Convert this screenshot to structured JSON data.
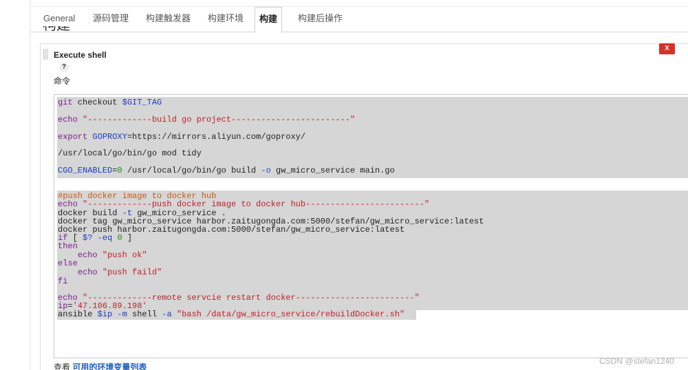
{
  "tabs": [
    {
      "label": "General",
      "active": false
    },
    {
      "label": "源码管理",
      "active": false
    },
    {
      "label": "构建触发器",
      "active": false
    },
    {
      "label": "构建环境",
      "active": false
    },
    {
      "label": "构建",
      "active": true
    },
    {
      "label": "构建后操作",
      "active": false
    }
  ],
  "section_title": "构建",
  "step": {
    "title": "Execute shell",
    "help_label": "?",
    "delete_label": "X",
    "field_label": "命令"
  },
  "script_lines": [
    "git checkout $GIT_TAG",
    "echo \"-------------build go project------------------------\"",
    "export GOPROXY=https://mirrors.aliyun.com/goproxy/",
    "/usr/local/go/bin/go mod tidy",
    "CGO_ENABLED=0 /usr/local/go/bin/go build -o gw_micro_service main.go",
    "#push docker image to docker hub",
    "echo \"-------------push docker image to docker hub------------------------\"",
    "docker build -t gw_micro_service .",
    "docker tag gw_micro_service harbor.zaitugongda.com:5000/stefan/gw_micro_service:latest",
    "docker push harbor.zaitugongda.com:5000/stefan/gw_micro_service:latest",
    "if [ $? -eq 0 ]",
    "then",
    "    echo \"push ok\"",
    "else",
    "    echo \"push faild\"",
    "fi",
    "echo \"-------------remote servcie restart docker------------------------\"",
    "ip='47.106.89.198'",
    "ansible $ip -m shell -a \"bash /data/gw_micro_service/rebuildDocker.sh\""
  ],
  "footer": {
    "prefix": "查看",
    "link": "可用的环境变量列表"
  },
  "watermark": "CSDN @stefan1240",
  "colors": {
    "delete_button": "#d9302c",
    "selection": "#d6d6d6",
    "link": "#1f5fbf"
  }
}
